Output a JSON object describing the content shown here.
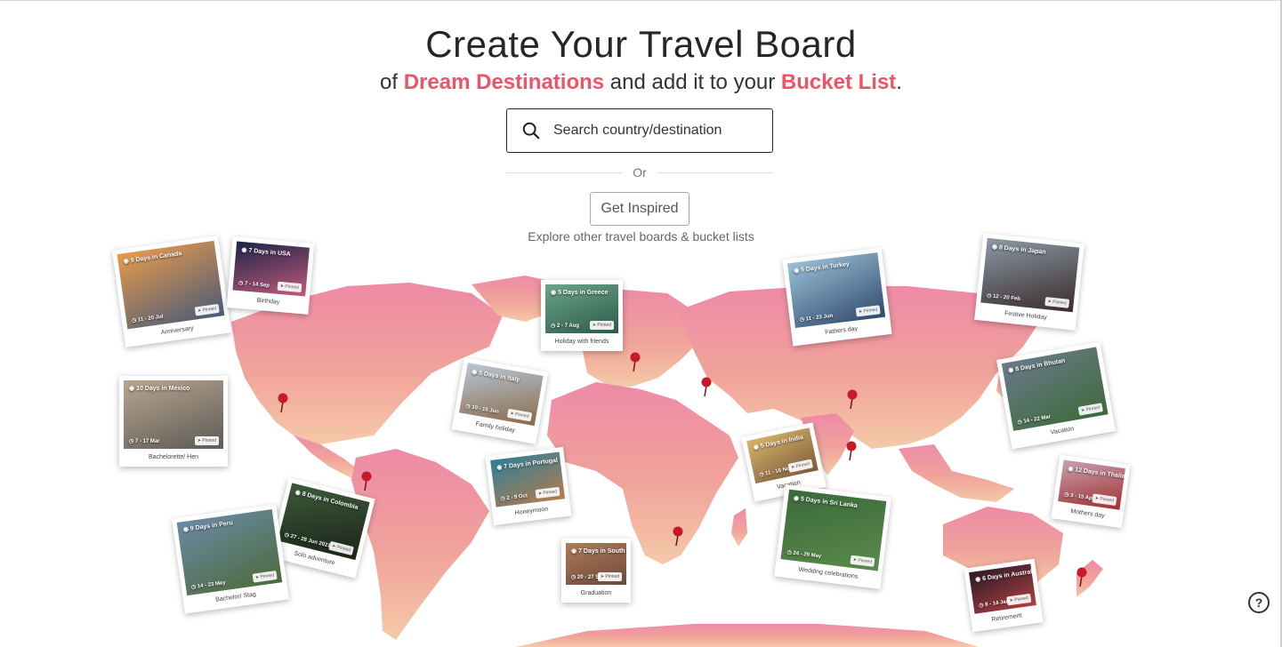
{
  "hero": {
    "title_prefix": "Create Your ",
    "title_bold": "Travel Board",
    "sub_1": "of ",
    "sub_accent_1": "Dream Destinations",
    "sub_2": " and add it to your ",
    "sub_accent_2": "Bucket List",
    "sub_3": "."
  },
  "search": {
    "placeholder": "Search country/destination",
    "value": ""
  },
  "divider_label": "Or",
  "inspire_button": "Get Inspired",
  "explore_text": "Explore other travel boards & bucket lists",
  "pinned_label": "Pinned",
  "colors": {
    "accent": "#ef5466",
    "map_top": "#ee8aa6",
    "map_bottom": "#f5c9a8",
    "pin": "#c9182b"
  },
  "cards": [
    {
      "title": "9 Days in Canada",
      "date": "11 - 20 Jul",
      "caption": "Anniversary"
    },
    {
      "title": "7 Days in USA",
      "date": "7 - 14 Sep",
      "caption": "Birthday"
    },
    {
      "title": "10 Days in Mexico",
      "date": "7 - 17 Mar",
      "caption": "Bachelorette/ Hen"
    },
    {
      "title": "5 Days in Italy",
      "date": "10 - 15 Jun",
      "caption": "Family holiday"
    },
    {
      "title": "5 Days in Greece",
      "date": "2 - 7 Aug",
      "caption": "Holiday with friends"
    },
    {
      "title": "7 Days in Portugal",
      "date": "2 - 9 Oct",
      "caption": "Honeymoon"
    },
    {
      "title": "8 Days in Colombia",
      "date": "27 - 28 Jun 2021",
      "caption": "Solo adventure"
    },
    {
      "title": "9 Days in Peru",
      "date": "14 - 23 May",
      "caption": "Bachelor/ Stag"
    },
    {
      "title": "7 Days in South Africa",
      "date": "20 - 27 Sep",
      "caption": "Graduation"
    },
    {
      "title": "5 Days in Turkey",
      "date": "11 - 23 Jun",
      "caption": "Fathers day"
    },
    {
      "title": "5 Days in India",
      "date": "11 - 16 Nov",
      "caption": "Vacation"
    },
    {
      "title": "5 Days in Sri Lanka",
      "date": "24 - 29 May",
      "caption": "Wedding celebrations"
    },
    {
      "title": "8 Days in Japan",
      "date": "12 - 20 Feb",
      "caption": "Festive Holiday"
    },
    {
      "title": "8 Days in Bhutan",
      "date": "14 - 22 Mar",
      "caption": "Vacation"
    },
    {
      "title": "12 Days in Thailand",
      "date": "3 - 15 Apr",
      "caption": "Mothers day"
    },
    {
      "title": "6 Days in Australia",
      "date": "8 - 14 Jan",
      "caption": "Retirement"
    }
  ],
  "help_symbol": "?"
}
